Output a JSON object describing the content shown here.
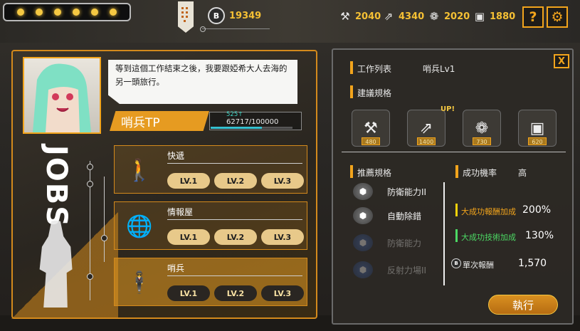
{
  "top": {
    "credits": "19349",
    "resources": [
      {
        "icon": "dumbbell-icon",
        "value": "2040"
      },
      {
        "icon": "arrows-icon",
        "value": "4340"
      },
      {
        "icon": "brain-icon",
        "value": "2020"
      },
      {
        "icon": "chip-icon",
        "value": "1880"
      }
    ],
    "help_label": "?",
    "credit_symbol": "B"
  },
  "job": {
    "dialog": "等到這個工作結束之後，我要跟婭希大人去海的另一頭旅行。",
    "tp_label": "哨兵TP",
    "tp_gain": "525↑",
    "tp_value": "62717/100000",
    "tp_fraction": 0.63,
    "side_title": "JOBS",
    "cards": [
      {
        "name": "快遞",
        "levels": [
          "LV.1",
          "LV.2",
          "LV.3"
        ]
      },
      {
        "name": "情報屋",
        "levels": [
          "LV.1",
          "LV.2",
          "LV.3"
        ]
      },
      {
        "name": "哨兵",
        "levels": [
          "LV.1",
          "LV.2",
          "LV.3"
        ]
      }
    ]
  },
  "detail": {
    "close_label": "X",
    "job_list_label": "工作列表",
    "job_list_value": "哨兵Lv1",
    "spec_label": "建議規格",
    "specs": [
      {
        "icon": "dumbbell-icon",
        "value": "480"
      },
      {
        "icon": "arrows-icon",
        "value": "1400"
      },
      {
        "icon": "brain-icon",
        "value": "730"
      },
      {
        "icon": "chip-icon",
        "value": "620"
      }
    ],
    "up_badge": "UP!",
    "recommend_label": "推薦規格",
    "recommend": [
      "防衛能力II",
      "自動除錯",
      "防衛能力",
      "反射力場II"
    ],
    "success_label": "成功機率",
    "success_value": "高",
    "big_reward_label": "大成功報酬加成",
    "big_reward_value": "200%",
    "big_tech_label": "大成功技術加成",
    "big_tech_value": "130%",
    "single_label": "單次報酬",
    "single_value": "1,570",
    "exec_label": "執行"
  },
  "colors": {
    "accent": "#f2a41c",
    "gold_text": "#f5c034",
    "tp_bar": "#35c0d0",
    "green_mark": "#4cd964",
    "yellow_mark": "#f5d20a"
  }
}
